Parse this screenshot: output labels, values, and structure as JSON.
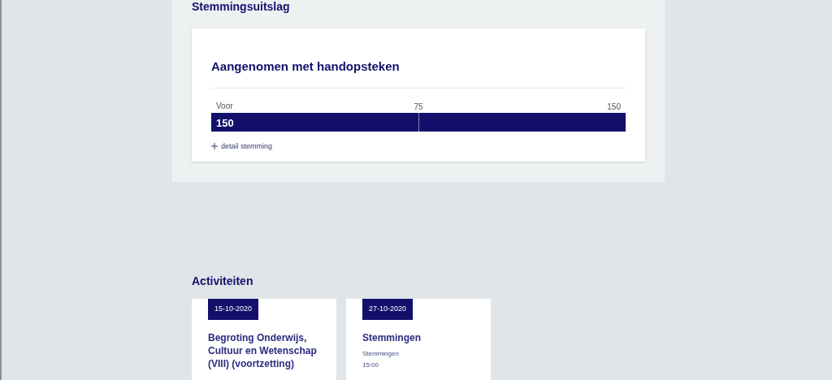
{
  "vote_result": {
    "heading": "Stemmingsuitslag",
    "title": "Aangenomen met handopsteken",
    "bar": {
      "label": "Voor",
      "count": "150",
      "level": 1,
      "mid_tick": "75",
      "max_tick": "150"
    },
    "detail_link": "detail stemming"
  },
  "activities": {
    "heading": "Activiteiten",
    "cards": [
      {
        "date": "15-10-2020",
        "title": "Begroting Onderwijs, Cultuur en Wetenschap (VIII) (voortzetting)"
      },
      {
        "date": "27-10-2020",
        "title": "Stemmingen",
        "subtitle": "Stemmingen",
        "time": "15:00"
      }
    ]
  }
}
